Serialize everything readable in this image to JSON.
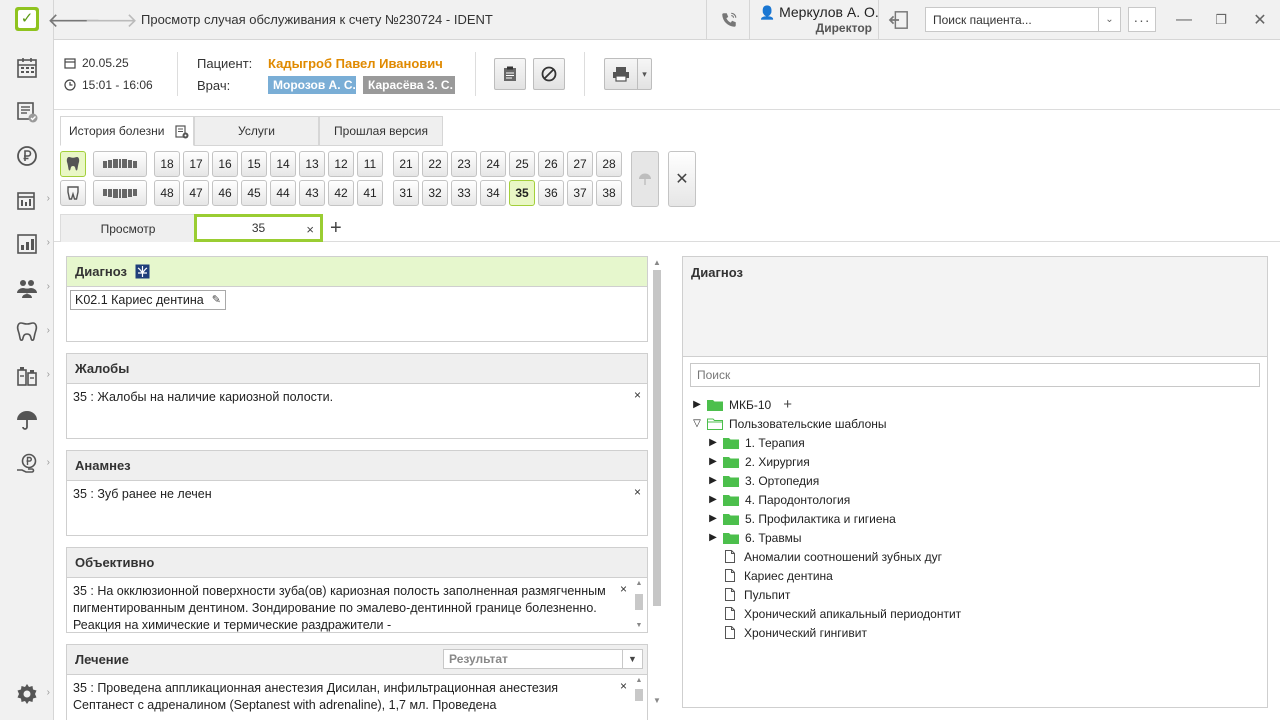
{
  "app": {
    "window_title": "Просмотр случая обслуживания к счету №230724 - IDENT",
    "user_name": "Меркулов А. О.",
    "user_role": "Директор",
    "patient_search_placeholder": "Поиск пациента...",
    "more_label": "···",
    "back_glyph": "🡐",
    "forward_glyph": "🡒",
    "minimize_glyph": "—",
    "maximize_glyph": "❐",
    "close_glyph": "✕"
  },
  "colors": {
    "accent_green": "#9acd32",
    "patient_orange": "#e08a00",
    "chip_doctor1": "#7aaed6",
    "chip_doctor2": "#9a9a9a",
    "folder_green": "#4cbf4c"
  },
  "header": {
    "date": "20.05.25",
    "time": "15:01 - 16:06",
    "patient_label": "Пациент:",
    "patient_name": "Кадыгроб Павел Иванович",
    "doctor_label": "Врач:",
    "doctors": [
      "Морозов А. С.",
      "Карасёва З. С."
    ]
  },
  "tabs": [
    "История болезни",
    "Услуги",
    "Прошлая версия"
  ],
  "teeth": {
    "upper_right": [
      "18",
      "17",
      "16",
      "15",
      "14",
      "13",
      "12",
      "11"
    ],
    "upper_left": [
      "21",
      "22",
      "23",
      "24",
      "25",
      "26",
      "27",
      "28"
    ],
    "lower_right": [
      "48",
      "47",
      "46",
      "45",
      "44",
      "43",
      "42",
      "41"
    ],
    "lower_left": [
      "31",
      "32",
      "33",
      "34",
      "35",
      "36",
      "37",
      "38"
    ],
    "selected": "35",
    "clear_glyph": "✕"
  },
  "subtabs": {
    "view_label": "Просмотр",
    "active_label": "35",
    "close_glyph": "×",
    "add_glyph": "+"
  },
  "sections": {
    "diagnosis": {
      "title": "Диагноз",
      "chip": "K02.1 Кариес дентина"
    },
    "complaints": {
      "title": "Жалобы",
      "text": "35 : Жалобы на наличие кариозной полости."
    },
    "anamnesis": {
      "title": "Анамнез",
      "text": "35 : Зуб ранее не лечен"
    },
    "objective": {
      "title": "Объективно",
      "text": "35 : На окклюзионной поверхности зуба(ов) кариозная полость заполненная размягченным пигментированным дентином. Зондирование по эмалево-дентинной границе болезненно. Реакция на химические и термические раздражители -"
    },
    "treatment": {
      "title": "Лечение",
      "result_placeholder": "Результат",
      "text": "35 : Проведена аппликационная анестезия Дисилан, инфильтрационная анестезия Септанест с адреналином (Septanest with adrenaline), 1,7 мл. Проведена"
    },
    "remove_glyph": "×"
  },
  "right_panel": {
    "title": "Диагноз",
    "search_placeholder": "Поиск",
    "tree": [
      {
        "label": "МКБ-10",
        "kind": "folder",
        "level": 0,
        "expanded": false,
        "add": true
      },
      {
        "label": "Пользовательские шаблоны",
        "kind": "folder-open",
        "level": 0,
        "expanded": true
      },
      {
        "label": "1. Терапия",
        "kind": "folder",
        "level": 1,
        "expanded": false
      },
      {
        "label": "2. Хирургия",
        "kind": "folder",
        "level": 1,
        "expanded": false
      },
      {
        "label": "3. Ортопедия",
        "kind": "folder",
        "level": 1,
        "expanded": false
      },
      {
        "label": "4. Пародонтология",
        "kind": "folder",
        "level": 1,
        "expanded": false
      },
      {
        "label": "5. Профилактика и гигиена",
        "kind": "folder",
        "level": 1,
        "expanded": false
      },
      {
        "label": "6. Травмы",
        "kind": "folder",
        "level": 1,
        "expanded": false
      },
      {
        "label": "Аномалии соотношений зубных дуг",
        "kind": "doc",
        "level": 1
      },
      {
        "label": "Кариес дентина",
        "kind": "doc",
        "level": 1
      },
      {
        "label": "Пульпит",
        "kind": "doc",
        "level": 1
      },
      {
        "label": "Хронический апикальный периодонтит",
        "kind": "doc",
        "level": 1
      },
      {
        "label": "Хронический гингивит",
        "kind": "doc",
        "level": 1
      }
    ]
  }
}
